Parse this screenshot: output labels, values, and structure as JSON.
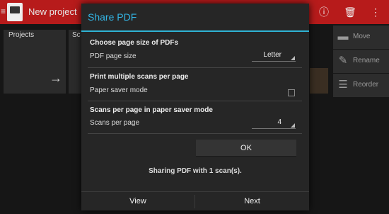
{
  "app": {
    "title": "New project",
    "menu_icon": "≡",
    "actions": [
      {
        "name": "info-icon",
        "glyph": "ⓘ"
      },
      {
        "name": "delete-icon",
        "glyph": "🗑"
      },
      {
        "name": "overflow-menu-icon",
        "glyph": "⋮"
      }
    ]
  },
  "main": {
    "projects_label": "Projects",
    "scans_label": "Sc",
    "arrow_glyph": "→"
  },
  "side_actions": [
    {
      "label": "Move",
      "icon": "folder-icon",
      "glyph": "▬"
    },
    {
      "label": "Rename",
      "icon": "pencil-icon",
      "glyph": "✎"
    },
    {
      "label": "Reorder",
      "icon": "reorder-icon",
      "glyph": "☰"
    }
  ],
  "dialog": {
    "title": "Share PDF",
    "page_size_section": "Choose page size of PDFs",
    "page_size_label": "PDF page size",
    "page_size_value": "Letter",
    "multi_section": "Print multiple scans per page",
    "paper_saver_label": "Paper saver mode",
    "paper_saver_checked": false,
    "per_page_section": "Scans per page in paper saver mode",
    "per_page_label": "Scans per page",
    "per_page_value": "4",
    "ok_label": "OK",
    "message": "Sharing PDF with 1 scan(s).",
    "view_label": "View",
    "next_label": "Next",
    "accent_color": "#33b5e5"
  }
}
